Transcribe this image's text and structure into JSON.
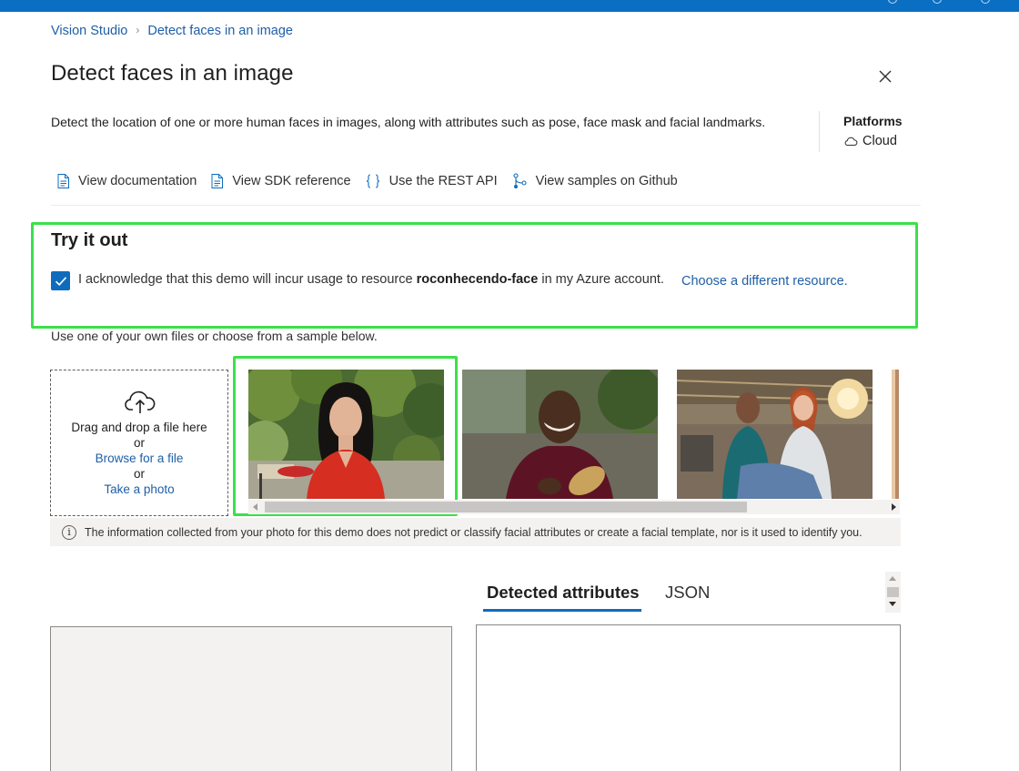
{
  "breadcrumb": {
    "root": "Vision Studio",
    "separator": "›",
    "current": "Detect faces in an image"
  },
  "page": {
    "title": "Detect faces in an image",
    "description": "Detect the location of one or more human faces in images, along with attributes such as pose, face mask and facial landmarks."
  },
  "platforms": {
    "title": "Platforms",
    "item": "Cloud",
    "item_icon": "cloud-icon"
  },
  "links": [
    {
      "label": "View documentation",
      "icon": "document-icon"
    },
    {
      "label": "View SDK reference",
      "icon": "document-icon"
    },
    {
      "label": "Use the REST API",
      "icon": "braces-icon"
    },
    {
      "label": "View samples on Github",
      "icon": "branch-icon"
    }
  ],
  "try_it_out": {
    "title": "Try it out",
    "checkbox_checked": true,
    "ack_prefix": "I acknowledge that this demo will incur usage to resource",
    "resource_name": "roconhecendo-face",
    "ack_suffix": "in my Azure account.",
    "choose_link": "Choose a different resource."
  },
  "samples": {
    "intro": "Use one of your own files or choose from a sample below.",
    "drop_title": "Drag and drop a file here",
    "or_1": "or",
    "browse": "Browse for a file",
    "or_2": "or",
    "take_photo": "Take a photo",
    "info": "The information collected from your photo for this demo does not predict or classify facial attributes or create a facial template, nor is it used to identify you."
  },
  "tabs": {
    "attributes": "Detected attributes",
    "json": "JSON",
    "active": "attributes"
  },
  "colors": {
    "accent": "#0f6cbd",
    "link": "#1e5fa6",
    "highlight": "#3ce04a",
    "topbar": "#0a6fc2"
  }
}
